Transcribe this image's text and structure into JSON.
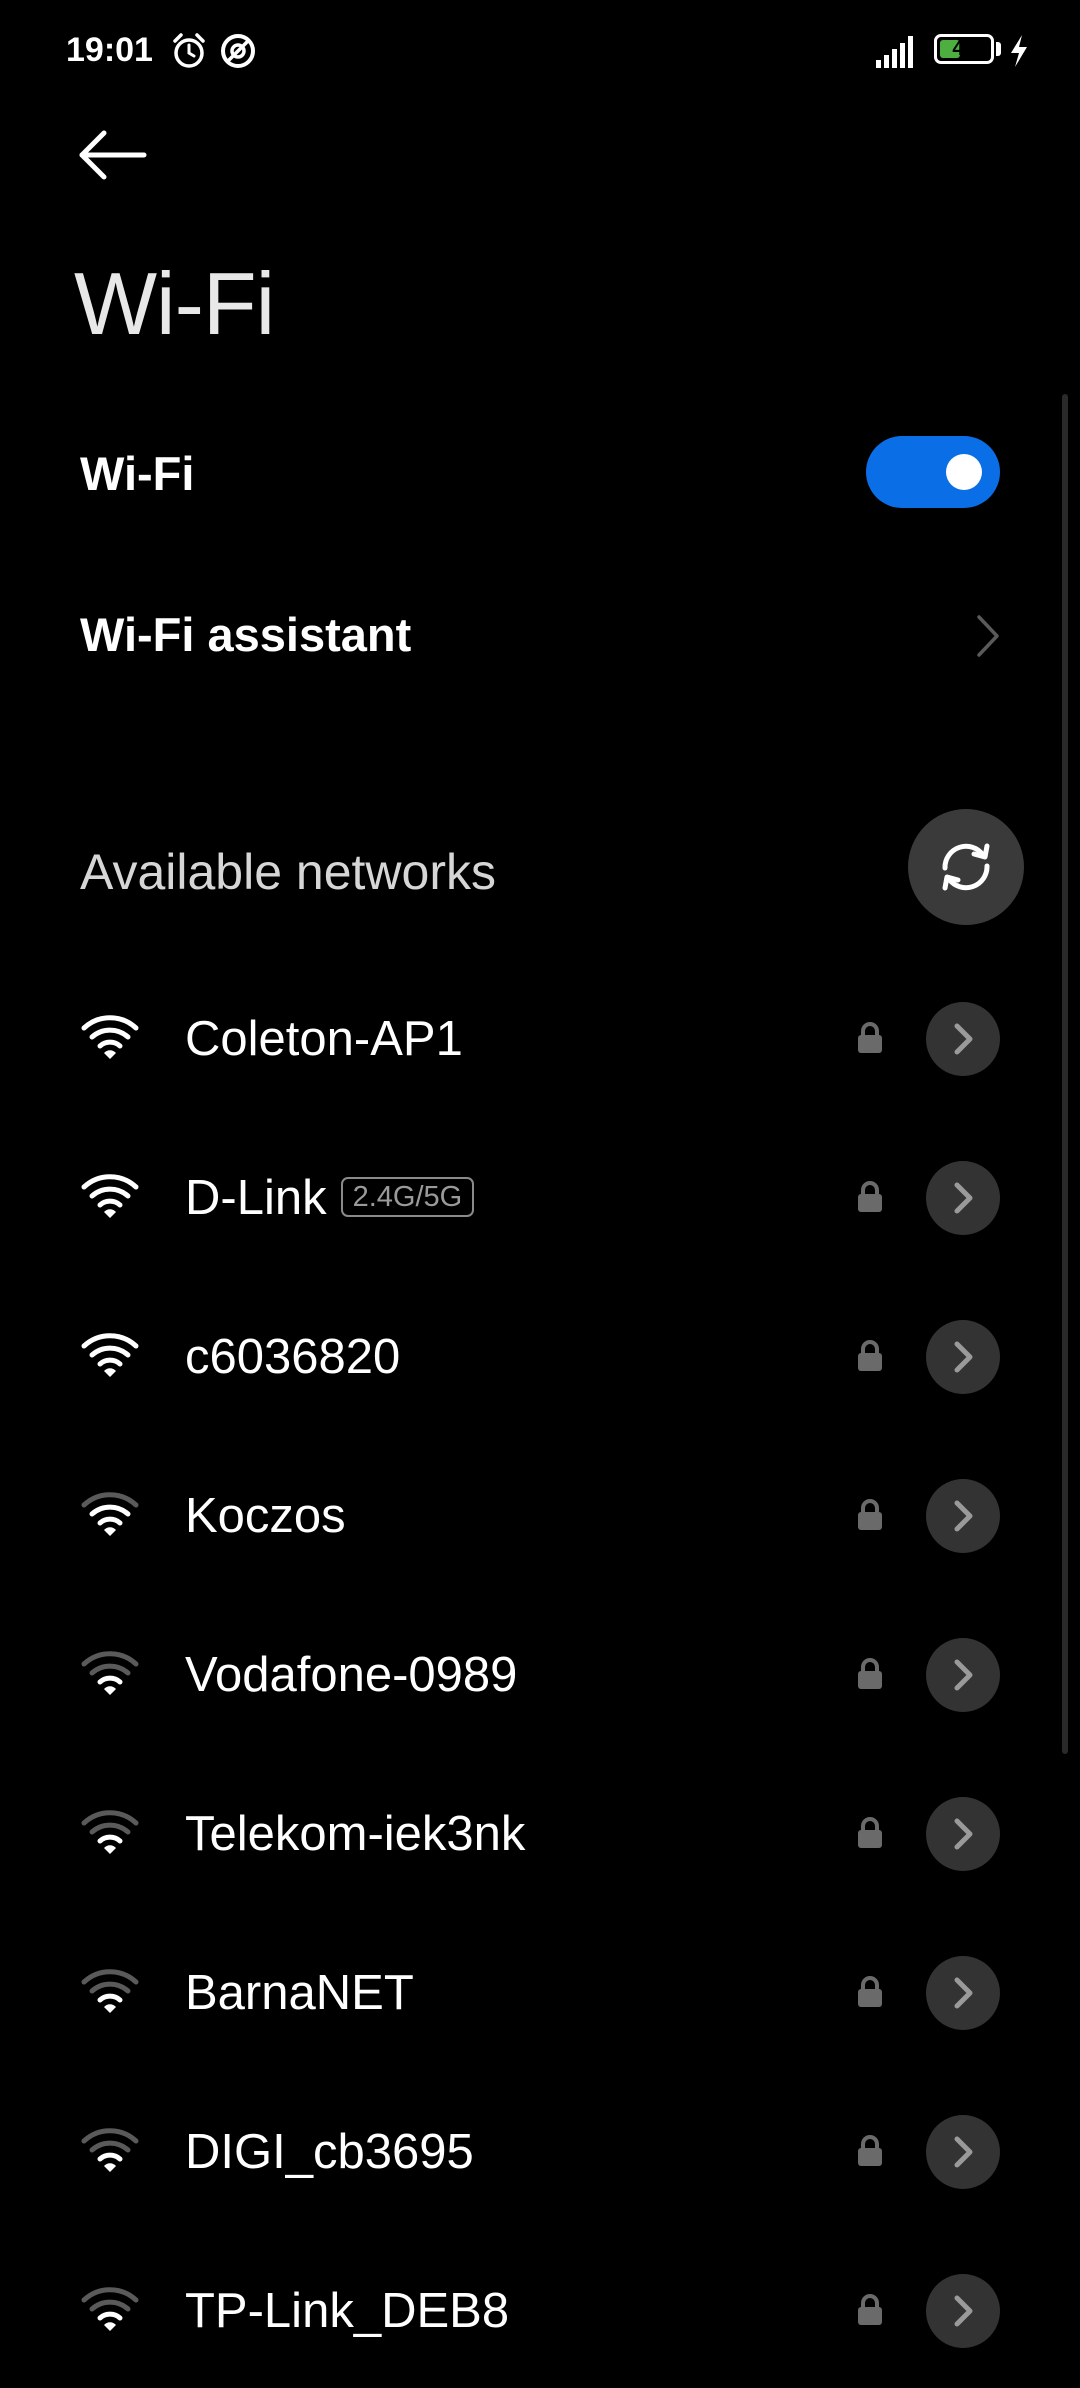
{
  "status_bar": {
    "time": "19:01",
    "battery_level": "41",
    "battery_fraction": 0.41,
    "icons": [
      "alarm-icon",
      "dnd-icon",
      "signal-icon",
      "battery-icon",
      "charging-icon"
    ]
  },
  "header": {
    "title": "Wi-Fi"
  },
  "settings": {
    "wifi_label": "Wi-Fi",
    "wifi_enabled": true,
    "assistant_label": "Wi-Fi assistant"
  },
  "networks_section": {
    "title": "Available networks"
  },
  "networks": [
    {
      "name": "Coleton-AP1",
      "badge": "",
      "secured": true,
      "signal": 4
    },
    {
      "name": "D-Link",
      "badge": "2.4G/5G",
      "secured": true,
      "signal": 4
    },
    {
      "name": "c6036820",
      "badge": "",
      "secured": true,
      "signal": 4
    },
    {
      "name": "Koczos",
      "badge": "",
      "secured": true,
      "signal": 3
    },
    {
      "name": "Vodafone-0989",
      "badge": "",
      "secured": true,
      "signal": 2
    },
    {
      "name": "Telekom-iek3nk",
      "badge": "",
      "secured": true,
      "signal": 2
    },
    {
      "name": "BarnaNET",
      "badge": "",
      "secured": true,
      "signal": 2
    },
    {
      "name": "DIGI_cb3695",
      "badge": "",
      "secured": true,
      "signal": 2
    },
    {
      "name": "TP-Link_DEB8",
      "badge": "",
      "secured": true,
      "signal": 2
    }
  ],
  "colors": {
    "background": "#000000",
    "accent": "#0a6fe6",
    "battery": "#4caf3f",
    "row_button": "#333333"
  }
}
